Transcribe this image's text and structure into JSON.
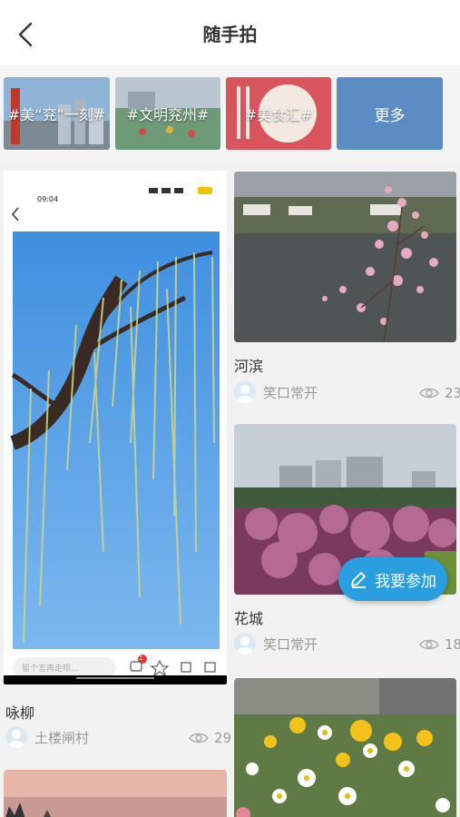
{
  "header": {
    "title": "随手拍"
  },
  "topics": [
    {
      "label": "#美“兖”一刻#"
    },
    {
      "label": "#文明兖州#"
    },
    {
      "label": "#美食汇#"
    },
    {
      "label": "更多"
    }
  ],
  "left_column": {
    "screenshot": {
      "time": "09:04",
      "comment_placeholder": "留个言再走呗...",
      "comment_badge": "1"
    },
    "post": {
      "title": "咏柳",
      "author": "土楼闸村",
      "views": "29"
    }
  },
  "right_column": {
    "posts": [
      {
        "title": "河滨",
        "author": "笑口常开",
        "views": "23"
      },
      {
        "title": "花城",
        "author": "笑口常开",
        "views": "18"
      }
    ]
  },
  "fab": {
    "label": "我要参加"
  },
  "colors": {
    "accent": "#2a9fe0",
    "topic_more_bg": "#5b8cc4"
  }
}
